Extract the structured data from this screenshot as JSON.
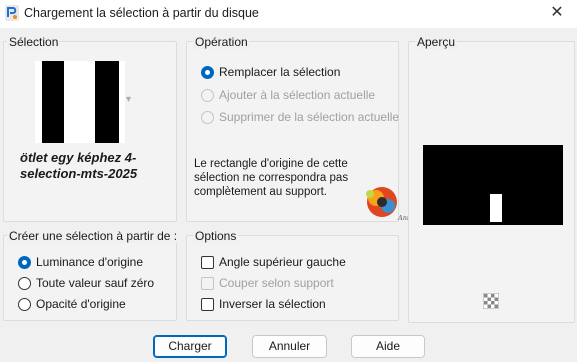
{
  "window": {
    "title": "Chargement la sélection à partir du disque",
    "app_icon": "paintshop-icon",
    "close_glyph": "✕"
  },
  "selection_panel": {
    "title": "Sélection",
    "thumbnail_caption_line1": "ötlet egy képhez  4-",
    "thumbnail_caption_line2": "selection-mts-2025",
    "dropdown_glyph": "▾"
  },
  "operation_panel": {
    "title": "Opération",
    "options": [
      {
        "label": "Remplacer la sélection",
        "checked": true,
        "enabled": true
      },
      {
        "label": "Ajouter à la sélection actuelle",
        "checked": false,
        "enabled": false
      },
      {
        "label": "Supprimer de la sélection actuelle",
        "checked": false,
        "enabled": false
      }
    ],
    "message_line1": "Le rectangle d'origine de cette",
    "message_line2": "sélection ne correspondra pas",
    "message_line3": "complètement au support."
  },
  "preview_panel": {
    "title": "Aperçu",
    "transparency_icon": "checker-icon"
  },
  "source_panel": {
    "title": "Créer une sélection à partir de :",
    "options": [
      {
        "label": "Luminance d'origine",
        "checked": true
      },
      {
        "label": "Toute valeur sauf zéro",
        "checked": false
      },
      {
        "label": "Opacité d'origine",
        "checked": false
      }
    ]
  },
  "options_panel": {
    "title": "Options",
    "checks": [
      {
        "label": "Angle supérieur gauche",
        "checked": false,
        "enabled": true
      },
      {
        "label": "Couper selon support",
        "checked": false,
        "enabled": false
      },
      {
        "label": "Inverser la sélection",
        "checked": false,
        "enabled": true
      }
    ]
  },
  "buttons": {
    "load": "Charger",
    "cancel": "Annuler",
    "help": "Aide"
  },
  "colors": {
    "accent": "#0067c0",
    "preview_bg": "#000000"
  }
}
